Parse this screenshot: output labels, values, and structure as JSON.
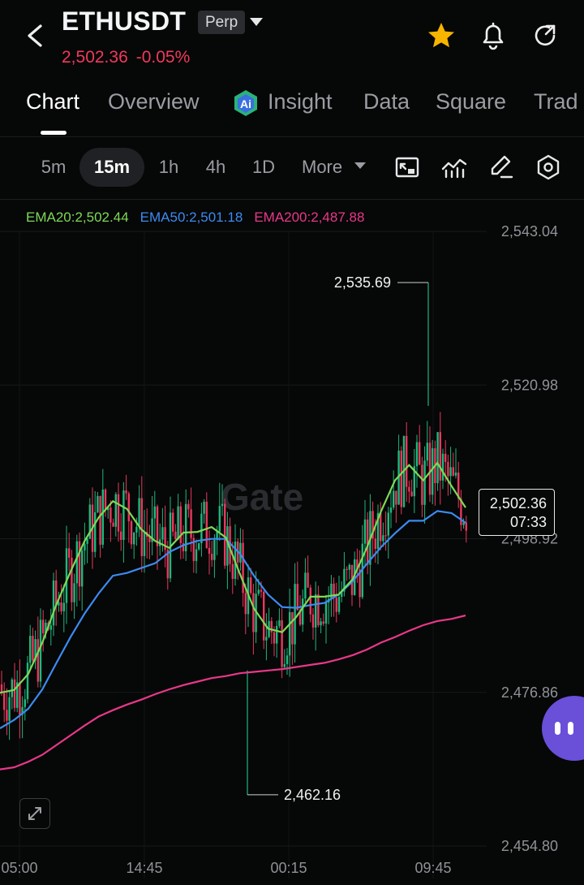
{
  "header": {
    "symbol": "ETHUSDT",
    "badge": "Perp",
    "last_price": "2,502.36",
    "change": "-0.05%"
  },
  "icons": {
    "back": "chevron-left-icon",
    "favorite": "star-icon",
    "alerts": "bell-icon",
    "share": "refresh-arrow-icon"
  },
  "tabs": [
    "Chart",
    "Overview",
    "Insight",
    "Data",
    "Square",
    "Trad"
  ],
  "active_tab": "Chart",
  "intervals": [
    "5m",
    "15m",
    "1h",
    "4h",
    "1D",
    "More"
  ],
  "active_interval": "15m",
  "toolbar_icons": [
    "compare-icon",
    "indicators-icon",
    "draw-icon",
    "settings-icon"
  ],
  "ema": {
    "ema20": "EMA20:2,502.44",
    "ema50": "EMA50:2,501.18",
    "ema200": "EMA200:2,487.88"
  },
  "price_tag": {
    "price": "2,502.36",
    "countdown": "07:33"
  },
  "colors": {
    "up": "#1fb77e",
    "down": "#e8385d",
    "ema20": "#7ed957",
    "ema50": "#3c8bf0",
    "ema200": "#e8388a"
  },
  "chart_data": {
    "type": "line",
    "y_ticks": [
      "2,543.04",
      "2,520.98",
      "2,498.92",
      "2,476.86",
      "2,454.80"
    ],
    "x_ticks": [
      "05:00",
      "14:45",
      "00:15",
      "09:45"
    ],
    "ylim": [
      2454.8,
      2543.04
    ],
    "high_label": "2,535.69",
    "low_label": "2,462.16",
    "series": [
      {
        "name": "EMA20",
        "values": [
          2476.8,
          2477.2,
          2479.5,
          2484.0,
          2489.5,
          2494.2,
          2498.6,
          2502.0,
          2504.3,
          2503.2,
          2500.3,
          2498.6,
          2497.6,
          2499.8,
          2499.9,
          2500.6,
          2499.1,
          2493.9,
          2488.9,
          2486.0,
          2485.5,
          2487.7,
          2490.6,
          2490.6,
          2490.9,
          2493.1,
          2497.6,
          2502.8,
          2507.3,
          2509.5,
          2507.3,
          2509.8,
          2506.5,
          2503.4
        ]
      },
      {
        "name": "EMA50",
        "values": [
          2471.7,
          2472.9,
          2474.5,
          2477.3,
          2481.1,
          2484.8,
          2488.2,
          2491.1,
          2493.6,
          2494.0,
          2494.7,
          2495.4,
          2497.0,
          2498.0,
          2498.6,
          2498.9,
          2498.9,
          2496.8,
          2493.6,
          2490.9,
          2489.1,
          2489.0,
          2489.4,
          2489.7,
          2490.9,
          2492.8,
          2495.3,
          2497.7,
          2499.7,
          2501.5,
          2501.5,
          2502.9,
          2502.6,
          2501.2
        ]
      },
      {
        "name": "EMA200",
        "values": [
          2465.8,
          2466.1,
          2466.9,
          2467.9,
          2469.3,
          2470.7,
          2472.1,
          2473.4,
          2474.3,
          2475.1,
          2475.8,
          2476.6,
          2477.3,
          2477.9,
          2478.4,
          2478.9,
          2479.2,
          2479.6,
          2479.8,
          2480.0,
          2480.2,
          2480.5,
          2480.8,
          2481.1,
          2481.6,
          2482.2,
          2483.0,
          2484.0,
          2484.8,
          2485.7,
          2486.5,
          2487.1,
          2487.4,
          2487.9
        ]
      }
    ]
  },
  "watermark": "Gate"
}
